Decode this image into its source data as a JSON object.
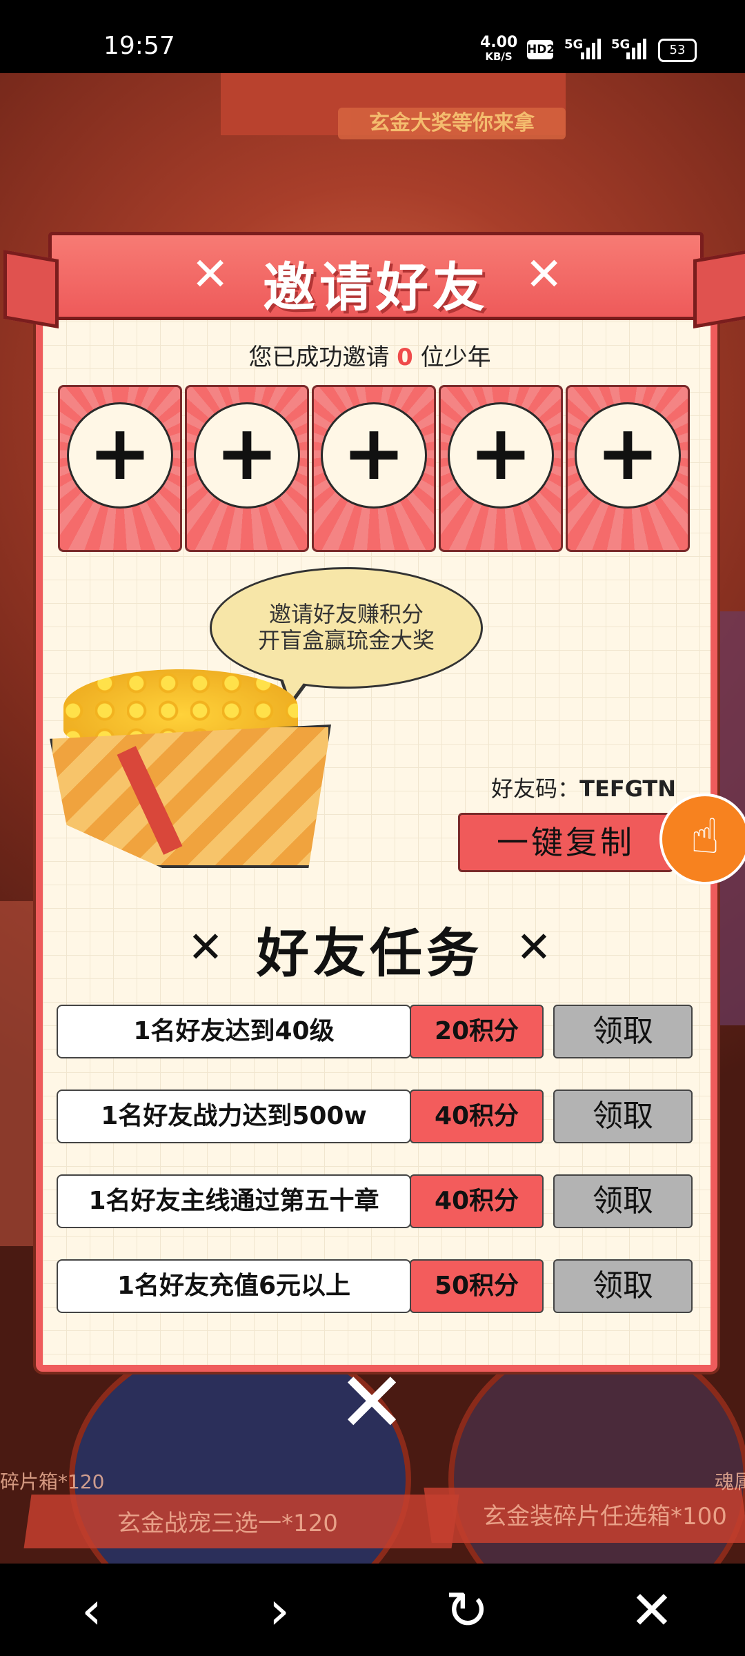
{
  "status_bar": {
    "time": "19:57",
    "net_speed": "4.00",
    "net_unit": "KB/S",
    "hd": "HD2",
    "sig1": "5G",
    "sig2": "5G",
    "battery": "53"
  },
  "background": {
    "subtitle": "玄金大奖等你来拿",
    "left_ribbon": "玄金战宠三选一*120",
    "right_ribbon": "玄金装碎片任选箱*100",
    "left_edge_text": "碎片箱*120",
    "right_edge_text": "魂属"
  },
  "panel": {
    "title": "邀请好友",
    "title_x_left": "✕",
    "title_x_right": "✕",
    "invited_prefix": "您已成功邀请",
    "invited_count": "0",
    "invited_suffix": "位少年",
    "slots": [
      "+",
      "+",
      "+",
      "+",
      "+"
    ],
    "bubble_line1": "邀请好友赚积分",
    "bubble_line2": "开盲盒赢琉金大奖",
    "friend_code_label": "好友码：",
    "friend_code": "TEFGTN",
    "copy_button": "一键复制",
    "tasks_title": "好友任务",
    "tasks": [
      {
        "desc": "1名好友达到40级",
        "points": "20积分",
        "action": "领取"
      },
      {
        "desc": "1名好友战力达到500w",
        "points": "40积分",
        "action": "领取"
      },
      {
        "desc": "1名好友主线通过第五十章",
        "points": "40积分",
        "action": "领取"
      },
      {
        "desc": "1名好友充值6元以上",
        "points": "50积分",
        "action": "领取"
      }
    ],
    "close": "✕"
  },
  "floating_button": "☝",
  "nav": {
    "back": "‹",
    "forward": "›",
    "refresh": "↻",
    "close": "✕"
  }
}
